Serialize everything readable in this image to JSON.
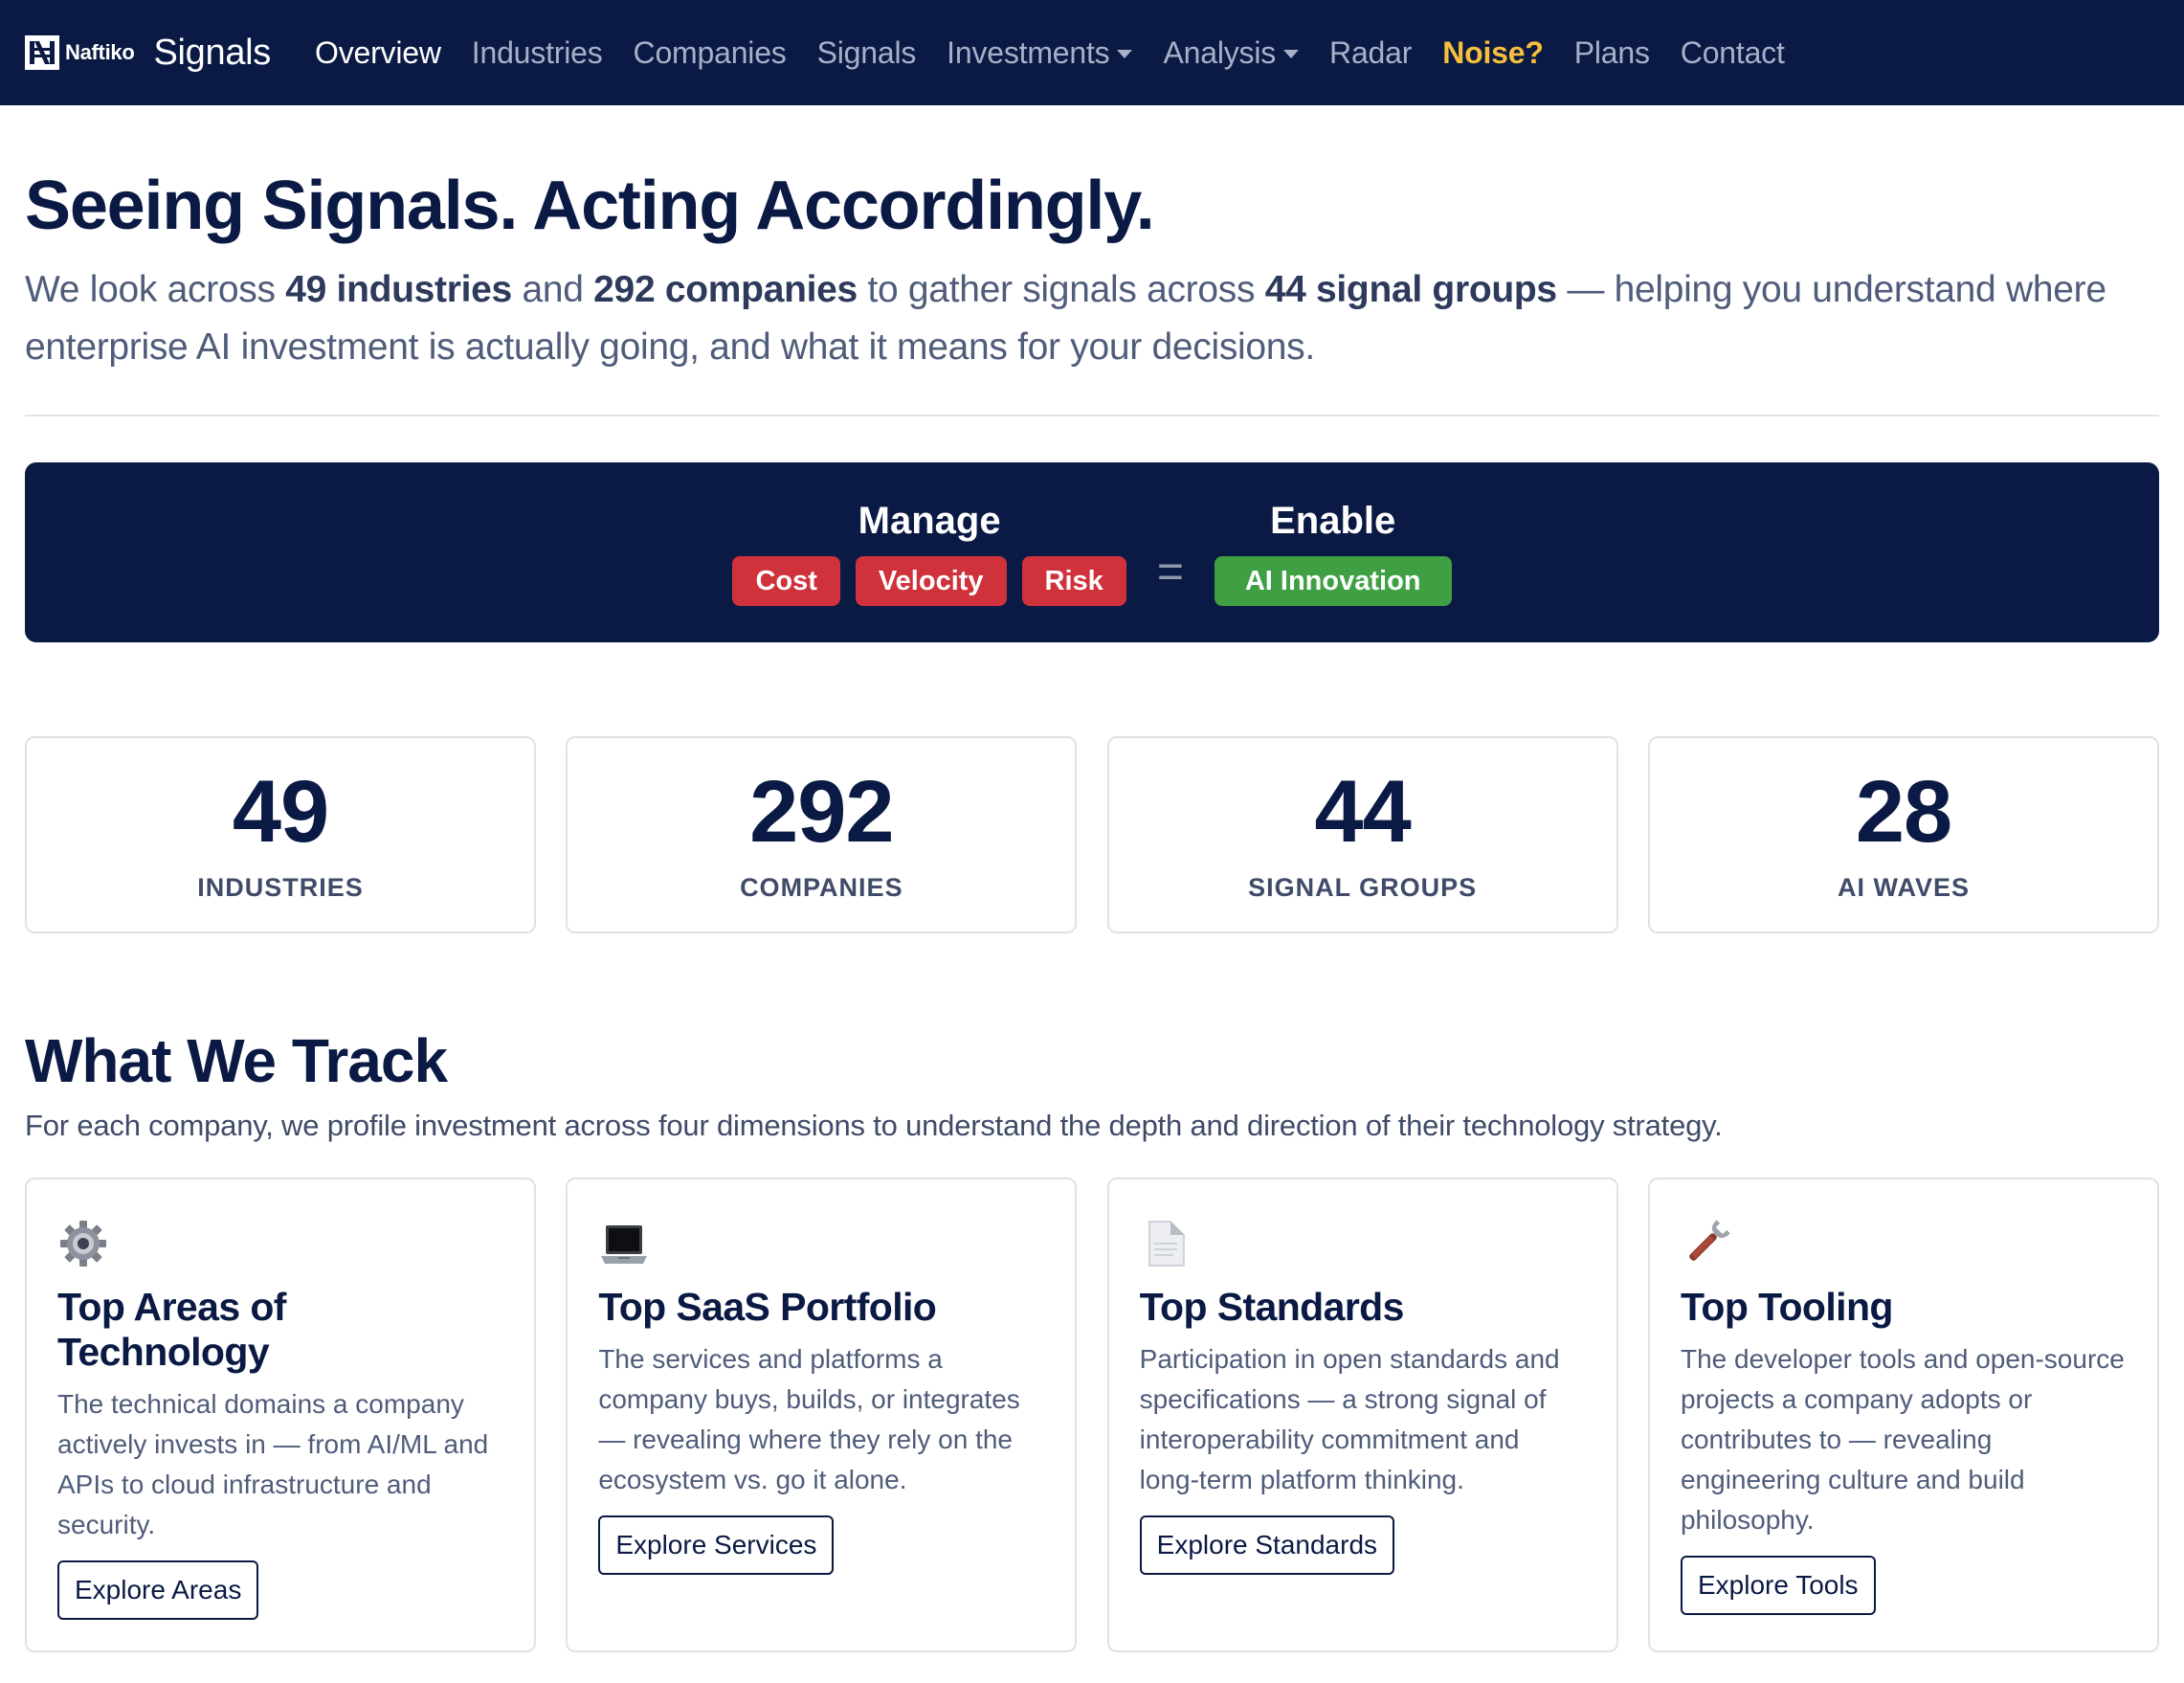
{
  "brand": {
    "logo_text": "Naftiko",
    "name": "Signals"
  },
  "nav": {
    "items": [
      {
        "label": "Overview"
      },
      {
        "label": "Industries"
      },
      {
        "label": "Companies"
      },
      {
        "label": "Signals"
      },
      {
        "label": "Investments"
      },
      {
        "label": "Analysis"
      },
      {
        "label": "Radar"
      },
      {
        "label": "Noise?"
      },
      {
        "label": "Plans"
      },
      {
        "label": "Contact"
      }
    ]
  },
  "hero": {
    "title": "Seeing Signals. Acting Accordingly.",
    "lead_1": "We look across ",
    "lead_industries": "49 industries",
    "lead_2": " and ",
    "lead_companies": "292 companies",
    "lead_3": " to gather signals across ",
    "lead_groups": "44 signal groups",
    "lead_4": " — helping you understand where enterprise AI investment is actually going, and what it means for your decisions."
  },
  "equation": {
    "left_heading": "Manage",
    "left_badges": [
      "Cost",
      "Velocity",
      "Risk"
    ],
    "sign": "=",
    "right_heading": "Enable",
    "right_badge": "AI Innovation",
    "colors": {
      "banner": "#0b1a44",
      "red": "#d0323c",
      "green": "#3fa043"
    }
  },
  "stats": [
    {
      "value": "49",
      "label": "INDUSTRIES"
    },
    {
      "value": "292",
      "label": "COMPANIES"
    },
    {
      "value": "44",
      "label": "SIGNAL GROUPS"
    },
    {
      "value": "28",
      "label": "AI WAVES"
    }
  ],
  "track": {
    "title": "What We Track",
    "lead": "For each company, we profile investment across four dimensions to understand the depth and direction of their technology strategy.",
    "cards": [
      {
        "icon": "gear-icon",
        "title": "Top Areas of Technology",
        "text": "The technical domains a company actively invests in — from AI/ML and APIs to cloud infrastructure and security.",
        "button": "Explore Areas"
      },
      {
        "icon": "laptop-icon",
        "title": "Top SaaS Portfolio",
        "text": "The services and platforms a company buys, builds, or integrates — revealing where they rely on the ecosystem vs. go it alone.",
        "button": "Explore Services"
      },
      {
        "icon": "document-icon",
        "title": "Top Standards",
        "text": "Participation in open standards and specifications — a strong signal of interoperability commitment and long-term platform thinking.",
        "button": "Explore Standards"
      },
      {
        "icon": "wrench-icon",
        "title": "Top Tooling",
        "text": "The developer tools and open-source projects a company adopts or contributes to — revealing engineering culture and build philosophy.",
        "button": "Explore Tools"
      }
    ]
  }
}
